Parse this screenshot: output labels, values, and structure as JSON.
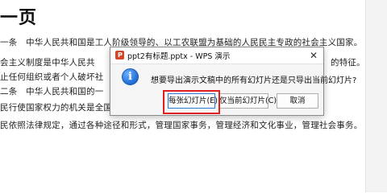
{
  "document": {
    "heading": "一页",
    "lines": [
      "一条　中华人民共和国是工人阶级领导的、以工农联盟为基础的人民民主专政的社会主义国家。",
      "会主义制度是中华人民共",
      "止任何组织或者个人破坏社",
      "二条　中华人民共和国的一",
      "民行使国家权力的机关是全国",
      "民依照法律规定，通过各种途径和形式，管理国家事务，管理经济和文化事业，管理社会事务。"
    ],
    "line_right_fragments": {
      "line2": "的特征。"
    }
  },
  "dialog": {
    "title": "ppt2有标题.pptx - WPS 演示",
    "close_symbol": "✕",
    "icon_glyph": "i",
    "message": "想要导出演示文稿中的所有幻灯片还是只导出当前幻灯片?",
    "buttons": {
      "all": "每张幻灯片(E)",
      "current": "仅当前幻灯片(C)",
      "cancel": "取消"
    }
  },
  "colors": {
    "highlight_border": "#e02020",
    "default_button_border": "#2a7ad6",
    "info_icon": "#2370d8",
    "ppt_icon": "#d24726"
  },
  "icons": {
    "info": "info-icon",
    "app": "wps-presentation-icon",
    "close": "close-icon"
  }
}
